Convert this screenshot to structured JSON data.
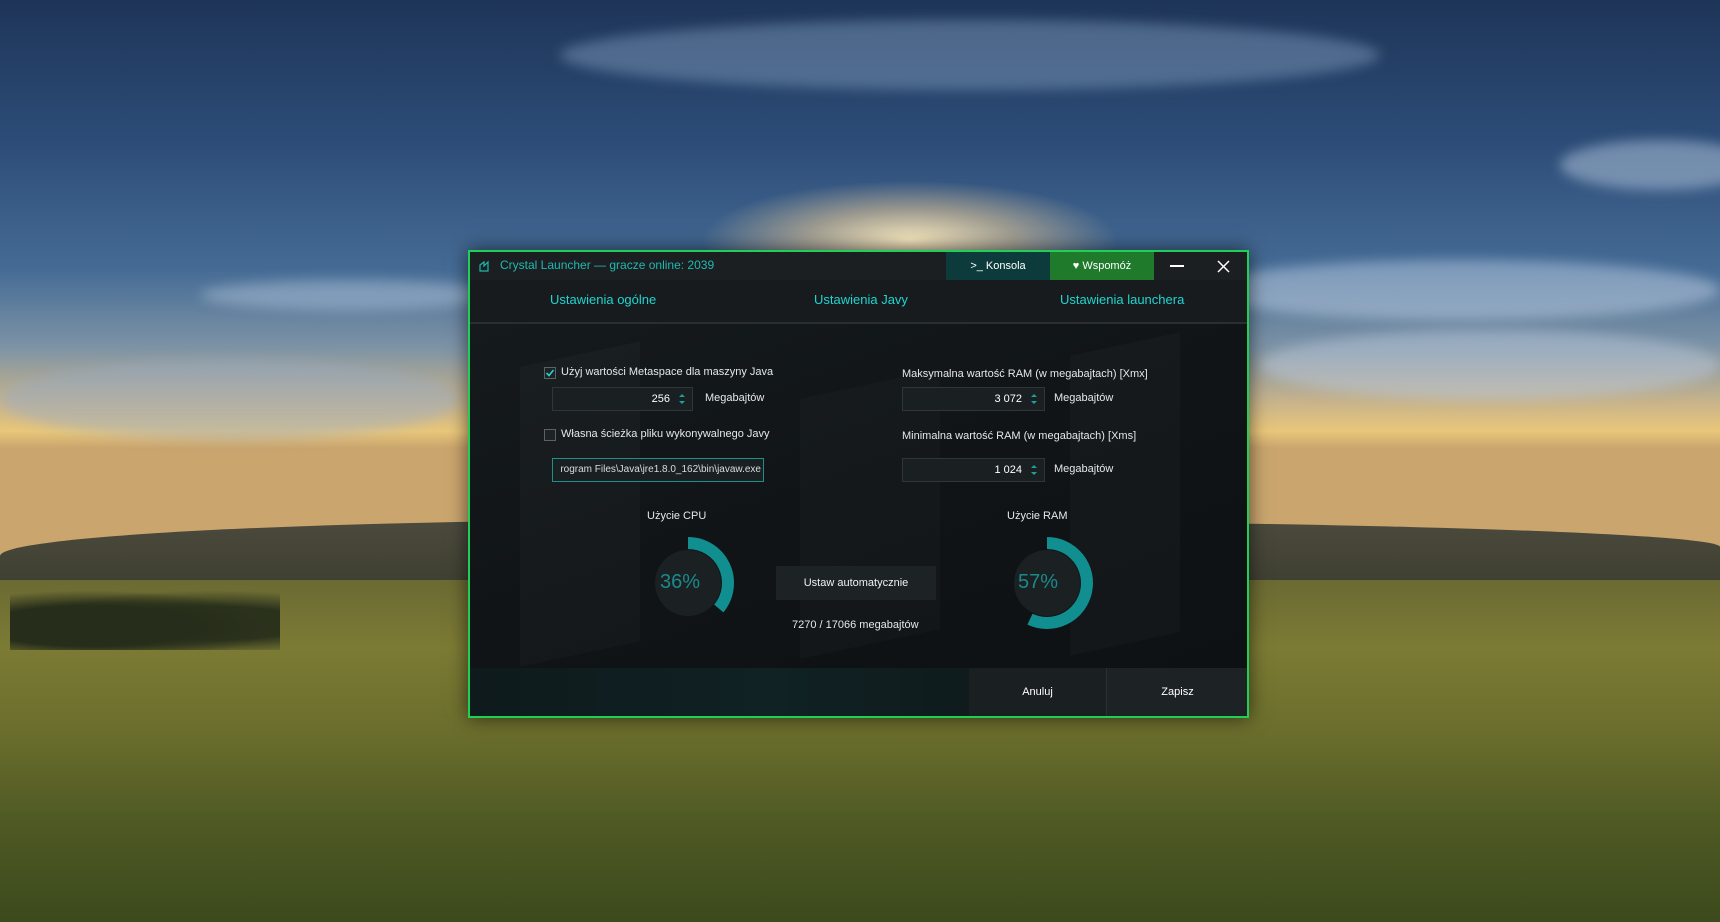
{
  "window": {
    "title": "Crystal Launcher — gracze online: 2039",
    "console_label": ">_ Konsola",
    "donate_label": "Wspomóż"
  },
  "tabs": [
    {
      "label": "Ustawienia ogólne"
    },
    {
      "label": "Ustawienia Javy"
    },
    {
      "label": "Ustawienia launchera"
    }
  ],
  "java": {
    "metaspace_label": "Użyj wartości Metaspace dla maszyny Java",
    "metaspace_checked": true,
    "metaspace_value": "256",
    "unit": "Megabajtów",
    "custom_path_label": "Własna ścieżka pliku wykonywalnego Javy",
    "custom_path_checked": false,
    "path_value": "rogram Files\\Java\\jre1.8.0_162\\bin\\javaw.exe",
    "xmx_label": "Maksymalna wartość RAM (w megabajtach) [Xmx]",
    "xmx_value": "3 072",
    "xms_label": "Minimalna wartość RAM (w megabajtach) [Xms]",
    "xms_value": "1 024"
  },
  "usage": {
    "cpu_title": "Użycie CPU",
    "cpu_text": "36%",
    "cpu_fraction": 0.36,
    "ram_title": "Użycie RAM",
    "ram_text": "57%",
    "ram_fraction": 0.57,
    "auto_label": "Ustaw automatycznie",
    "memory_text": "7270 / 17066 megabajtów"
  },
  "footer": {
    "cancel_label": "Anuluj",
    "save_label": "Zapisz"
  },
  "colors": {
    "accent": "#1fd5d1",
    "gauge": "#108e90",
    "border": "#1fcf56",
    "donate": "#1f7a2c"
  }
}
